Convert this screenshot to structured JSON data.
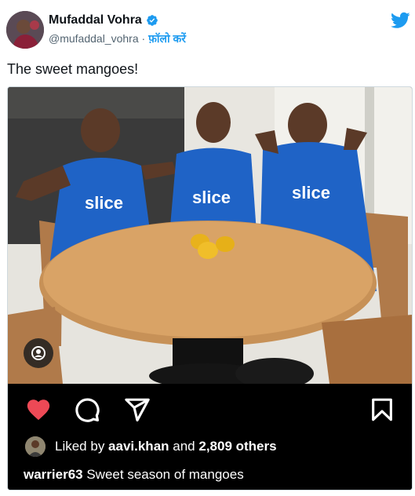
{
  "tweet": {
    "author_name": "Mufaddal Vohra",
    "handle": "@mufaddal_vohra",
    "separator": "·",
    "follow_label": "फ़ॉलो करें",
    "text": "The sweet mangoes!"
  },
  "embed": {
    "photo_alt": "Three cricketers in blue Mumbai Indians 'slice' jerseys around a round wooden table with three mangoes, posing as see no evil, speak no evil, hear no evil",
    "jersey_sponsor": "slice",
    "likes": {
      "prefix": "Liked by ",
      "user": "aavi.khan",
      "middle": " and ",
      "count": "2,809 others"
    },
    "caption": {
      "user": "warrier63",
      "text": " Sweet season of mangoes"
    }
  },
  "colors": {
    "twitter_blue": "#1d9bf0",
    "like_red": "#ed4956",
    "jersey_blue": "#1f63c6"
  },
  "icons": [
    "verified-icon",
    "twitter-bird-icon",
    "user-tag-icon",
    "heart-icon",
    "comment-icon",
    "share-icon",
    "bookmark-icon"
  ]
}
